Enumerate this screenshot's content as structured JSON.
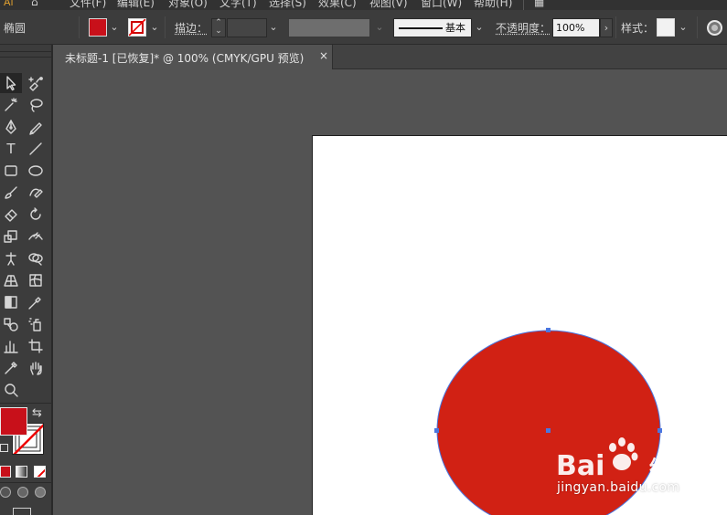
{
  "menubar": {
    "items": [
      "文件(F)",
      "编辑(E)",
      "对象(O)",
      "文字(T)",
      "选择(S)",
      "效果(C)",
      "视图(V)",
      "窗口(W)",
      "帮助(H)"
    ]
  },
  "controlbar": {
    "selection_label": "椭圆",
    "fill_color": "#c8101a",
    "stroke_label": "描边：",
    "stroke_profile_label": "基本",
    "opacity_label": "不透明度：",
    "opacity_value": "100%",
    "style_label": "样式："
  },
  "document": {
    "tab_title": "未标题-1 [已恢复]* @ 100% (CMYK/GPU 预览)",
    "close_symbol": "×"
  },
  "toolbar": {
    "fill_color": "#c8101a",
    "type_tool_glyph": "T"
  },
  "canvas": {
    "artboard_color": "#ffffff",
    "ellipse_fill": "#d12114",
    "selection_color": "#4a76e0"
  },
  "watermark": {
    "brand_text": "Bai du 经验",
    "url": "jingyan.baidu.com"
  }
}
